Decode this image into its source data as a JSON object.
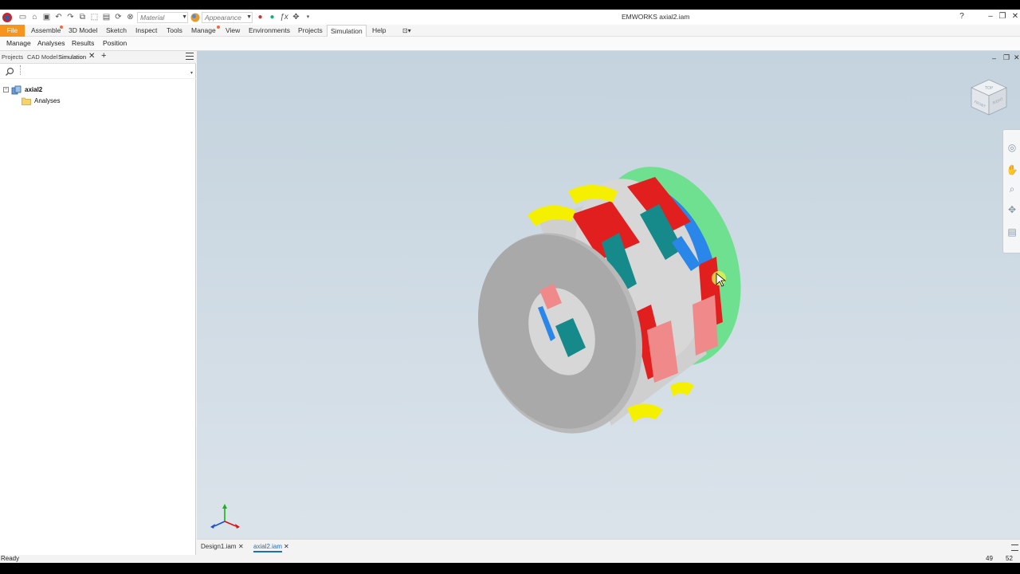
{
  "app": {
    "window_title": "EMWORKS   axial2.iam",
    "material_placeholder": "Material",
    "appearance_placeholder": "Appearance"
  },
  "menu": {
    "file": "File",
    "assemble": "Assemble",
    "model3d": "3D Model",
    "sketch": "Sketch",
    "inspect": "Inspect",
    "tools": "Tools",
    "manage": "Manage",
    "view": "View",
    "environments": "Environments",
    "projects": "Projects",
    "simulation": "Simulation",
    "help": "Help"
  },
  "ribbon": {
    "manage": "Manage",
    "analyses": "Analyses",
    "results": "Results",
    "position": "Position"
  },
  "panel": {
    "tabs": [
      "Projects",
      "CAD Model",
      "Simulation"
    ],
    "add": "+",
    "tree": {
      "root": "axial2",
      "child": "Analyses"
    }
  },
  "viewcube": {
    "top": "TOP",
    "front": "FRONT",
    "right": "RIGHT"
  },
  "doc_tabs": [
    "Design1.iam",
    "axial2.iam"
  ],
  "status": {
    "text": "Ready",
    "num1": "49",
    "num2": "52"
  },
  "colors": {
    "accent_orange": "#f7941d",
    "active_tab_blue": "#1a6fc4",
    "stator_grey": "#b9b9b9",
    "magnet_teal": "#168a8a",
    "magnet_pink": "#f08a8a",
    "magnet_yellow": "#f5f000",
    "magnet_red": "#e01b1b",
    "magnet_blue": "#1e7fe0",
    "housing_green": "#66dd88"
  }
}
